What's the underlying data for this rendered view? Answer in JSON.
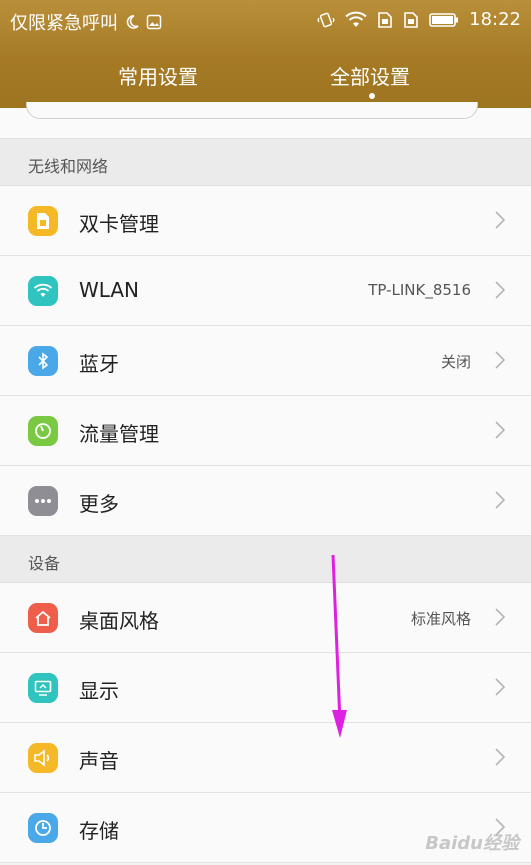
{
  "status_bar": {
    "carrier_text": "仅限紧急呼叫",
    "time": "18:22"
  },
  "tabs": [
    {
      "label": "常用设置",
      "active": false
    },
    {
      "label": "全部设置",
      "active": true
    }
  ],
  "sections": [
    {
      "title": "无线和网络",
      "items": [
        {
          "label": "双卡管理",
          "value": "",
          "icon": "sim-card-icon",
          "color": "#f5b928"
        },
        {
          "label": "WLAN",
          "value": "TP-LINK_8516",
          "icon": "wifi-icon",
          "color": "#2fc4c0"
        },
        {
          "label": "蓝牙",
          "value": "关闭",
          "icon": "bluetooth-icon",
          "color": "#4aa8e8"
        },
        {
          "label": "流量管理",
          "value": "",
          "icon": "data-usage-icon",
          "color": "#7ac943"
        },
        {
          "label": "更多",
          "value": "",
          "icon": "more-icon",
          "color": "#8e8e94"
        }
      ]
    },
    {
      "title": "设备",
      "items": [
        {
          "label": "桌面风格",
          "value": "标准风格",
          "icon": "home-icon",
          "color": "#ef5e4b"
        },
        {
          "label": "显示",
          "value": "",
          "icon": "display-icon",
          "color": "#2fc4c0"
        },
        {
          "label": "声音",
          "value": "",
          "icon": "sound-icon",
          "color": "#f5b928"
        },
        {
          "label": "存储",
          "value": "",
          "icon": "storage-icon",
          "color": "#4aa8e8"
        }
      ]
    }
  ],
  "watermark": "Baidu经验",
  "annotation": {
    "color": "#e020e0"
  }
}
